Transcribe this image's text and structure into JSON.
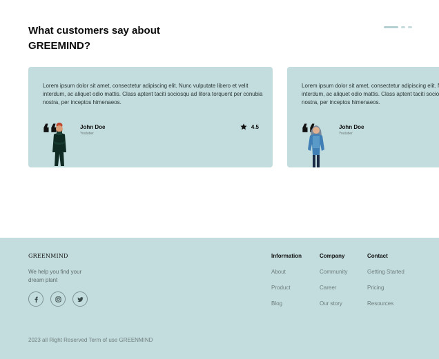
{
  "testimonials": {
    "title": "What customers say about GREEMIND?",
    "cards": [
      {
        "text": "Lorem ipsum dolor sit amet, consectetur adipiscing elit. Nunc vulputate libero et velit interdum, ac aliquet odio mattis. Class aptent taciti sociosqu ad litora torquent per conubia nostra, per inceptos himenaeos.",
        "name": "John Doe",
        "role": "Youtuber",
        "rating": "4.5"
      },
      {
        "text": "Lorem ipsum dolor sit amet, consectetur adipiscing elit. Nunc vulputate libero et velit interdum, ac aliquet odio mattis. Class aptent taciti sociosqu ad litora torquent per conubia nostra, per inceptos himenaeos.",
        "name": "John Doe",
        "role": "Youtuber"
      }
    ],
    "quote_glyph": "❛❛",
    "pager": {
      "count": 3,
      "active": 1
    }
  },
  "footer": {
    "brand": "GREENMIND",
    "tagline": "We help you find your dream plant",
    "socials": [
      "facebook-icon",
      "instagram-icon",
      "twitter-icon"
    ],
    "columns": {
      "information": {
        "title": "Information",
        "links": [
          "About",
          "Product",
          "Blog"
        ]
      },
      "company": {
        "title": "Company",
        "links": [
          "Community",
          "Career",
          "Our story"
        ]
      },
      "contact": {
        "title": "Contact",
        "links": [
          "Getting Started",
          "Pricing",
          "Resources"
        ]
      }
    },
    "copyright": "2023 all Right Reserved Term of use GREENMIND"
  },
  "colors": {
    "card_bg": "#c3dcdd",
    "footer_bg": "#c3dcdd",
    "accent": "#b4d0d3"
  }
}
